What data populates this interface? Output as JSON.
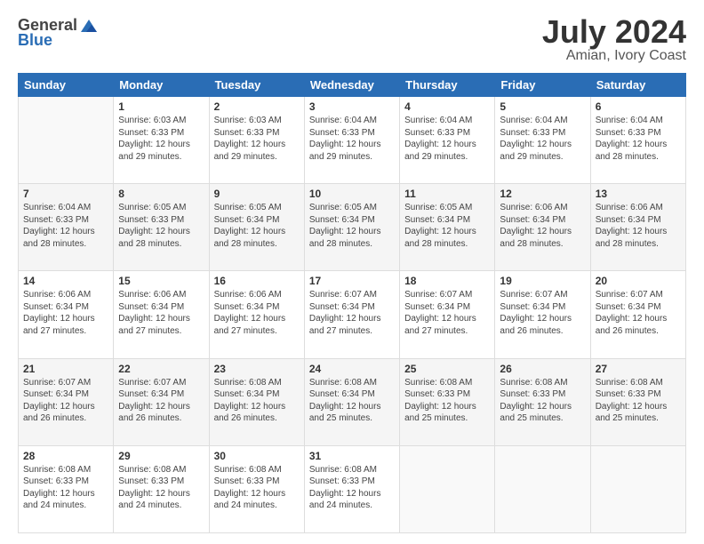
{
  "header": {
    "logo_general": "General",
    "logo_blue": "Blue",
    "title": "July 2024",
    "subtitle": "Amian, Ivory Coast"
  },
  "days_of_week": [
    "Sunday",
    "Monday",
    "Tuesday",
    "Wednesday",
    "Thursday",
    "Friday",
    "Saturday"
  ],
  "weeks": [
    [
      {
        "day": "",
        "info": ""
      },
      {
        "day": "1",
        "info": "Sunrise: 6:03 AM\nSunset: 6:33 PM\nDaylight: 12 hours\nand 29 minutes."
      },
      {
        "day": "2",
        "info": "Sunrise: 6:03 AM\nSunset: 6:33 PM\nDaylight: 12 hours\nand 29 minutes."
      },
      {
        "day": "3",
        "info": "Sunrise: 6:04 AM\nSunset: 6:33 PM\nDaylight: 12 hours\nand 29 minutes."
      },
      {
        "day": "4",
        "info": "Sunrise: 6:04 AM\nSunset: 6:33 PM\nDaylight: 12 hours\nand 29 minutes."
      },
      {
        "day": "5",
        "info": "Sunrise: 6:04 AM\nSunset: 6:33 PM\nDaylight: 12 hours\nand 29 minutes."
      },
      {
        "day": "6",
        "info": "Sunrise: 6:04 AM\nSunset: 6:33 PM\nDaylight: 12 hours\nand 28 minutes."
      }
    ],
    [
      {
        "day": "7",
        "info": "Sunrise: 6:04 AM\nSunset: 6:33 PM\nDaylight: 12 hours\nand 28 minutes."
      },
      {
        "day": "8",
        "info": "Sunrise: 6:05 AM\nSunset: 6:33 PM\nDaylight: 12 hours\nand 28 minutes."
      },
      {
        "day": "9",
        "info": "Sunrise: 6:05 AM\nSunset: 6:34 PM\nDaylight: 12 hours\nand 28 minutes."
      },
      {
        "day": "10",
        "info": "Sunrise: 6:05 AM\nSunset: 6:34 PM\nDaylight: 12 hours\nand 28 minutes."
      },
      {
        "day": "11",
        "info": "Sunrise: 6:05 AM\nSunset: 6:34 PM\nDaylight: 12 hours\nand 28 minutes."
      },
      {
        "day": "12",
        "info": "Sunrise: 6:06 AM\nSunset: 6:34 PM\nDaylight: 12 hours\nand 28 minutes."
      },
      {
        "day": "13",
        "info": "Sunrise: 6:06 AM\nSunset: 6:34 PM\nDaylight: 12 hours\nand 28 minutes."
      }
    ],
    [
      {
        "day": "14",
        "info": "Sunrise: 6:06 AM\nSunset: 6:34 PM\nDaylight: 12 hours\nand 27 minutes."
      },
      {
        "day": "15",
        "info": "Sunrise: 6:06 AM\nSunset: 6:34 PM\nDaylight: 12 hours\nand 27 minutes."
      },
      {
        "day": "16",
        "info": "Sunrise: 6:06 AM\nSunset: 6:34 PM\nDaylight: 12 hours\nand 27 minutes."
      },
      {
        "day": "17",
        "info": "Sunrise: 6:07 AM\nSunset: 6:34 PM\nDaylight: 12 hours\nand 27 minutes."
      },
      {
        "day": "18",
        "info": "Sunrise: 6:07 AM\nSunset: 6:34 PM\nDaylight: 12 hours\nand 27 minutes."
      },
      {
        "day": "19",
        "info": "Sunrise: 6:07 AM\nSunset: 6:34 PM\nDaylight: 12 hours\nand 26 minutes."
      },
      {
        "day": "20",
        "info": "Sunrise: 6:07 AM\nSunset: 6:34 PM\nDaylight: 12 hours\nand 26 minutes."
      }
    ],
    [
      {
        "day": "21",
        "info": "Sunrise: 6:07 AM\nSunset: 6:34 PM\nDaylight: 12 hours\nand 26 minutes."
      },
      {
        "day": "22",
        "info": "Sunrise: 6:07 AM\nSunset: 6:34 PM\nDaylight: 12 hours\nand 26 minutes."
      },
      {
        "day": "23",
        "info": "Sunrise: 6:08 AM\nSunset: 6:34 PM\nDaylight: 12 hours\nand 26 minutes."
      },
      {
        "day": "24",
        "info": "Sunrise: 6:08 AM\nSunset: 6:34 PM\nDaylight: 12 hours\nand 25 minutes."
      },
      {
        "day": "25",
        "info": "Sunrise: 6:08 AM\nSunset: 6:33 PM\nDaylight: 12 hours\nand 25 minutes."
      },
      {
        "day": "26",
        "info": "Sunrise: 6:08 AM\nSunset: 6:33 PM\nDaylight: 12 hours\nand 25 minutes."
      },
      {
        "day": "27",
        "info": "Sunrise: 6:08 AM\nSunset: 6:33 PM\nDaylight: 12 hours\nand 25 minutes."
      }
    ],
    [
      {
        "day": "28",
        "info": "Sunrise: 6:08 AM\nSunset: 6:33 PM\nDaylight: 12 hours\nand 24 minutes."
      },
      {
        "day": "29",
        "info": "Sunrise: 6:08 AM\nSunset: 6:33 PM\nDaylight: 12 hours\nand 24 minutes."
      },
      {
        "day": "30",
        "info": "Sunrise: 6:08 AM\nSunset: 6:33 PM\nDaylight: 12 hours\nand 24 minutes."
      },
      {
        "day": "31",
        "info": "Sunrise: 6:08 AM\nSunset: 6:33 PM\nDaylight: 12 hours\nand 24 minutes."
      },
      {
        "day": "",
        "info": ""
      },
      {
        "day": "",
        "info": ""
      },
      {
        "day": "",
        "info": ""
      }
    ]
  ]
}
